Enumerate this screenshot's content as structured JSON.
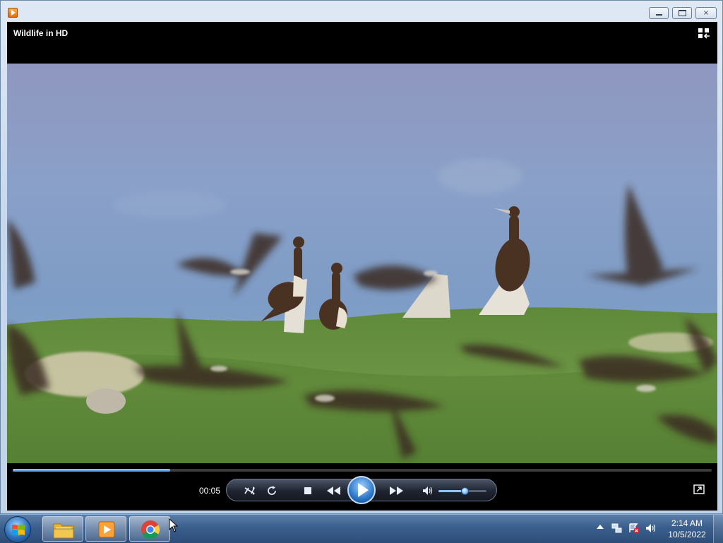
{
  "window": {
    "icon": "media-player-icon",
    "buttons": {
      "minimize": "minimize-icon",
      "maximize": "restore-icon",
      "close": "×"
    }
  },
  "player": {
    "title": "Wildlife in HD",
    "switch_icon": "switch-to-library-icon",
    "progress": 0.225,
    "elapsed": "00:05",
    "volume": 0.55,
    "controls": [
      "shuffle-icon",
      "repeat-icon",
      "stop-icon",
      "previous-icon",
      "play-icon",
      "next-icon",
      "volume-icon"
    ],
    "fullscreen_icon": "fullscreen-icon"
  },
  "taskbar": {
    "pinned": [
      "windows-explorer-icon",
      "windows-media-player-icon",
      "chrome-icon"
    ],
    "tray": [
      "show-hidden-icons-icon",
      "network-icon",
      "action-center-icon",
      "volume-icon"
    ],
    "clock": {
      "time": "2:14 AM",
      "date": "10/5/2022"
    }
  },
  "colors": {
    "accent": "#3f86d6",
    "taskbar": "#3b5f8d"
  }
}
